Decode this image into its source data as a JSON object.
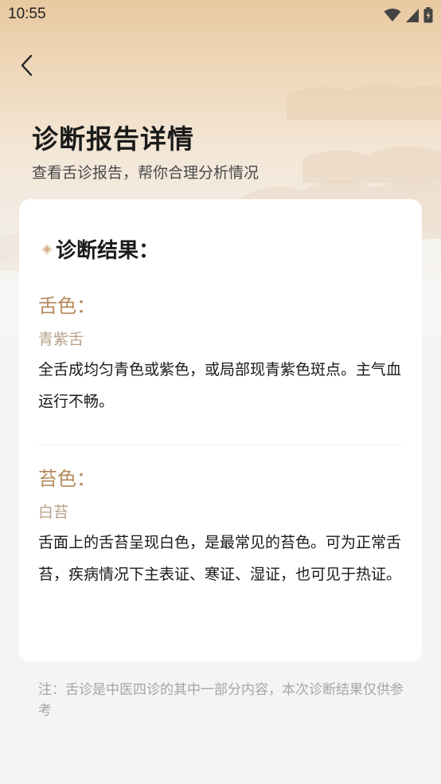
{
  "status_bar": {
    "time": "10:55",
    "icons": [
      "wifi-icon",
      "signal-icon",
      "battery-charging-icon"
    ]
  },
  "nav": {
    "back_icon": "chevron-left-icon"
  },
  "header": {
    "title": "诊断报告详情",
    "subtitle": "查看舌诊报告，帮你合理分析情况"
  },
  "card": {
    "result_title": "诊断结果：",
    "title_icon": "diamond-icon",
    "sections": [
      {
        "heading": "舌色：",
        "type": "青紫舌",
        "description": "全舌成均匀青色或紫色，或局部现青紫色斑点。主气血运行不畅。"
      },
      {
        "heading": "苔色：",
        "type": "白苔",
        "description": "舌面上的舌苔呈现白色，是最常见的苔色。可为正常舌苔，疾病情况下主表证、寒证、湿证，也可见于热证。"
      }
    ]
  },
  "footnote": "注：舌诊是中医四诊的其中一部分内容，本次诊断结果仅供参考",
  "colors": {
    "accent": "#b58a5d",
    "type_text": "#b9a18a",
    "header_gradient_top": "#e8c9a0",
    "page_bg": "#f4f4f4"
  }
}
